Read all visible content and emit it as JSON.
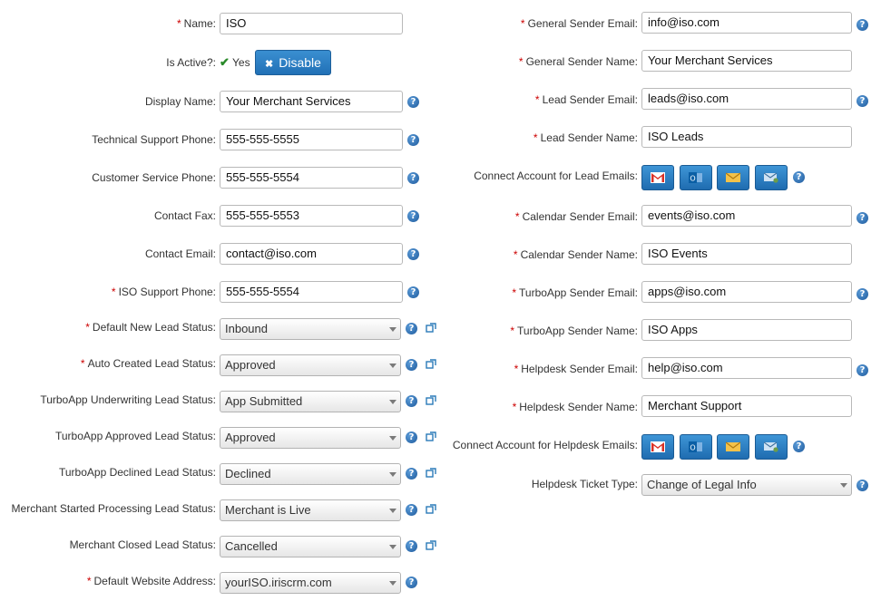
{
  "left": {
    "name": {
      "label": "Name:",
      "required": true,
      "value": "ISO"
    },
    "is_active": {
      "label": "Is Active?:",
      "value": "Yes",
      "button": "Disable"
    },
    "display_name": {
      "label": "Display Name:",
      "value": "Your Merchant Services"
    },
    "tech_phone": {
      "label": "Technical Support Phone:",
      "value": "555-555-5555"
    },
    "cs_phone": {
      "label": "Customer Service Phone:",
      "value": "555-555-5554"
    },
    "fax": {
      "label": "Contact Fax:",
      "value": "555-555-5553"
    },
    "email": {
      "label": "Contact Email:",
      "value": "contact@iso.com"
    },
    "iso_phone": {
      "label": "ISO Support Phone:",
      "required": true,
      "value": "555-555-5554"
    },
    "default_new": {
      "label": "Default New Lead Status:",
      "required": true,
      "value": "Inbound"
    },
    "auto_created": {
      "label": "Auto Created Lead Status:",
      "required": true,
      "value": "Approved"
    },
    "uw": {
      "label": "TurboApp Underwriting Lead Status:",
      "value": "App Submitted"
    },
    "approved": {
      "label": "TurboApp Approved Lead Status:",
      "value": "Approved"
    },
    "declined": {
      "label": "TurboApp Declined Lead Status:",
      "value": "Declined"
    },
    "started": {
      "label": "Merchant Started Processing Lead Status:",
      "value": "Merchant is Live"
    },
    "closed": {
      "label": "Merchant Closed Lead Status:",
      "value": "Cancelled"
    },
    "website": {
      "label": "Default Website Address:",
      "required": true,
      "value": "yourISO.iriscrm.com"
    }
  },
  "right": {
    "gen_email": {
      "label": "General Sender Email:",
      "required": true,
      "value": "info@iso.com"
    },
    "gen_name": {
      "label": "General Sender Name:",
      "required": true,
      "value": "Your Merchant Services"
    },
    "lead_email": {
      "label": "Lead Sender Email:",
      "required": true,
      "value": "leads@iso.com"
    },
    "lead_name": {
      "label": "Lead Sender Name:",
      "required": true,
      "value": "ISO Leads"
    },
    "connect_lead": {
      "label": "Connect Account for Lead Emails:"
    },
    "cal_email": {
      "label": "Calendar Sender Email:",
      "required": true,
      "value": "events@iso.com"
    },
    "cal_name": {
      "label": "Calendar Sender Name:",
      "required": true,
      "value": "ISO Events"
    },
    "ta_email": {
      "label": "TurboApp Sender Email:",
      "required": true,
      "value": "apps@iso.com"
    },
    "ta_name": {
      "label": "TurboApp Sender Name:",
      "required": true,
      "value": "ISO Apps"
    },
    "hd_email": {
      "label": "Helpdesk Sender Email:",
      "required": true,
      "value": "help@iso.com"
    },
    "hd_name": {
      "label": "Helpdesk Sender Name:",
      "required": true,
      "value": "Merchant Support"
    },
    "connect_hd": {
      "label": "Connect Account for Helpdesk Emails:"
    },
    "ticket_type": {
      "label": "Helpdesk Ticket Type:",
      "value": "Change of Legal Info"
    }
  },
  "ui": {
    "required_mark": "*",
    "help_glyph": "?",
    "disable_x": "✖",
    "check": "✔",
    "colors": {
      "accent": "#2170b6",
      "required": "#cc0000",
      "check": "#2a8a2a",
      "help": "#1e5a9c"
    }
  }
}
